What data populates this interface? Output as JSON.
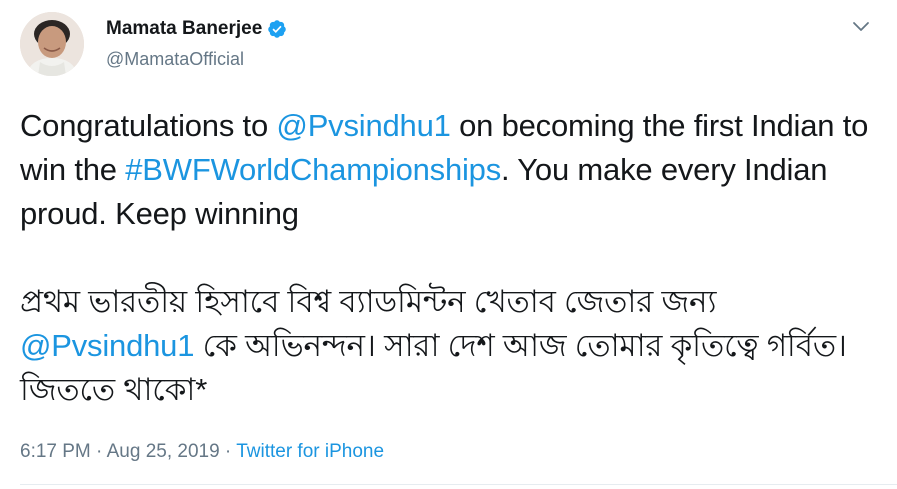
{
  "author": {
    "name": "Mamata Banerjee",
    "handle": "@MamataOfficial",
    "verified": true
  },
  "tweet": {
    "en": {
      "t1": "Congratulations to ",
      "mention": "@Pvsindhu1",
      "t2": " on becoming the first Indian to win the ",
      "hashtag": "#BWFWorldChampionships",
      "t3": ". You make every Indian proud. Keep winning"
    },
    "bn": {
      "t1": "প্রথম ভারতীয় হিসাবে বিশ্ব ব্যাডমিন্টন খেতাব জেতার জন্য ",
      "mention": "@Pvsindhu1",
      "t2": " কে অভিনন্দন। সারা দেশ আজ তোমার কৃতিত্বে গর্বিত। জিততে থাকো*"
    }
  },
  "meta": {
    "time": "6:17 PM",
    "sep1": " · ",
    "date": "Aug 25, 2019",
    "sep2": " · ",
    "source": "Twitter for iPhone"
  },
  "icons": {
    "verified": "verified-badge-icon",
    "menu": "chevron-down-icon"
  },
  "colors": {
    "link": "#1b95e0",
    "secondary_text": "#657786",
    "primary_text": "#14171a"
  }
}
